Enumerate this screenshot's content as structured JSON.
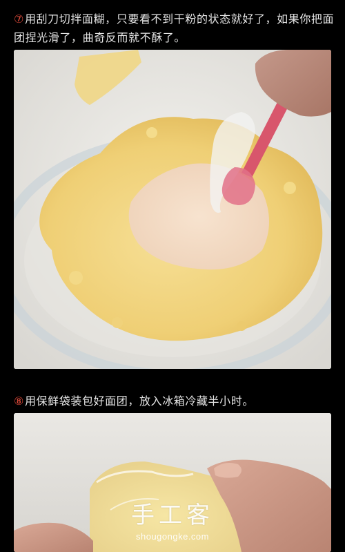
{
  "steps": [
    {
      "number": "⑦",
      "text": "用刮刀切拌面糊，只要看不到干粉的状态就好了，如果你把面团捏光滑了，曲奇反而就不酥了。"
    },
    {
      "number": "⑧",
      "text": "用保鲜袋装包好面团，放入冰箱冷藏半小时。"
    }
  ],
  "watermark": {
    "logo_text": "手工客",
    "url": "shougongke.com"
  },
  "colors": {
    "background": "#000000",
    "text": "#e6e6e6",
    "step_number": "#e34b3b",
    "dough": "#f1d47e",
    "spatula": "#d8566c"
  }
}
